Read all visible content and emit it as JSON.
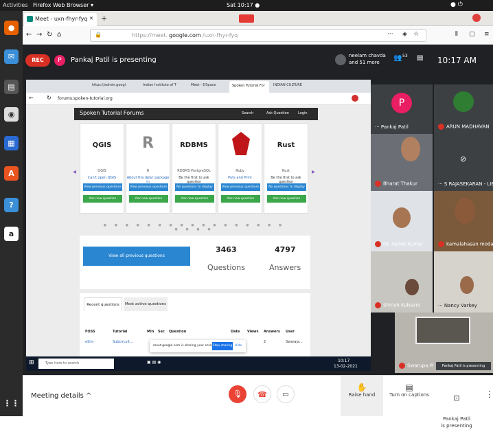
{
  "topbar": {
    "activities": "Activities",
    "app": "Firefox Web Browser ▾",
    "clock": "Sat 10:17 ●"
  },
  "firefox": {
    "tab_title": "Meet - uxn-fhyr-fyq",
    "tab_close": "✕",
    "new_tab": "+",
    "url_prefix": "https://meet.",
    "url_domain": "google.com",
    "url_suffix": "/uxn-fhyr-fyq",
    "menu_dots": "···"
  },
  "meet": {
    "rec": "REC",
    "presenter_initial": "P",
    "presenting": "Pankaj Patil is presenting",
    "participants": "neelam chavda\nand 51 more",
    "people_count": "53",
    "time": "10:17 AM"
  },
  "chrome": {
    "tabs": [
      "https://admin.googl",
      "Indian Institute of T",
      "Meet - DSpace",
      "Spoken Tutorial For",
      "INDIAN CULTURE"
    ],
    "address": "forums.spoken-tutorial.org",
    "site": {
      "brand": "Spoken Tutorial Forums",
      "search": "Search",
      "ask": "Ask Question",
      "login": "Login",
      "cards": [
        {
          "title": "QGIS",
          "name": "QGIS",
          "q": "Can't open QGIS",
          "b1": "View previous questions",
          "b2": "Ask new question"
        },
        {
          "title": "R",
          "name": "R",
          "q": "About the dplyr package in",
          "b1": "View previous questions",
          "b2": "Ask new question"
        },
        {
          "title": "RDBMS",
          "name": "RDBMS PostgreSQL",
          "q": "Be the first to ask question",
          "b1": "No questions to display",
          "b2": "Ask new question"
        },
        {
          "title": "Ruby",
          "name": "Ruby",
          "q": "Puts and Print",
          "b1": "View previous questions",
          "b2": "Ask new question"
        },
        {
          "title": "Rust",
          "name": "Rust",
          "q": "Be the first to ask question",
          "b1": "No questions to display",
          "b2": "Ask new question"
        }
      ],
      "view_all": "View all previous questions",
      "questions_count": "3463",
      "questions_label": "Questions",
      "answers_count": "4797",
      "answers_label": "Answers",
      "tabs": [
        "Recent questions",
        "Most active questions"
      ],
      "table_headers": [
        "FOSS",
        "Tutorial",
        "Min",
        "Sec",
        "Question",
        "Date",
        "Views",
        "Answers",
        "User"
      ],
      "row": {
        "foss": "eSim",
        "tutorial": "Subcircuit...",
        "question": "",
        "views": "2",
        "user": "Swaraja..."
      },
      "share_msg": "meet.google.com is sharing your screen.",
      "stop": "Stop sharing",
      "hide": "Hide"
    },
    "taskbar": {
      "search": "Type here to search",
      "time": "10:17",
      "date": "13-02-2021"
    }
  },
  "tiles": [
    {
      "name": "Pankaj Patil"
    },
    {
      "name": "ARUN MADHAVAN"
    },
    {
      "name": "Bharat Thakur"
    },
    {
      "name": "S RAJASEKARAN - LIB"
    },
    {
      "name": "Dr. Ashok Kumar"
    },
    {
      "name": "kamalahasan modali"
    },
    {
      "name": "Shirish Kulkarni"
    },
    {
      "name": "Nancy Varkey"
    },
    {
      "name": "Swarupa Pi"
    }
  ],
  "tile_badge": "Pankaj Patil is presenting",
  "bottom": {
    "meeting_details": "Meeting details",
    "chevron": "^",
    "raise_hand": "Raise hand",
    "captions": "Turn on captions",
    "presenting": "Pankaj Patil\nis presenting"
  },
  "colors": {
    "meet_bg": "#202124",
    "end_call": "#ea4335",
    "rec": "#d93025",
    "accent": "#1a73e8",
    "presenter": "#e91e63"
  }
}
